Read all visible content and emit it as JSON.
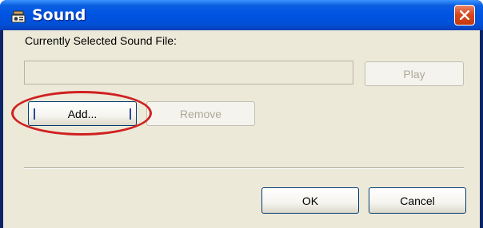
{
  "window": {
    "title": "Sound",
    "app_icon": "sound-app-icon",
    "close_icon": "close-icon",
    "close_color": "#d9481d"
  },
  "dialog": {
    "selected_label": "Currently Selected Sound File:",
    "selected_file_value": "",
    "buttons": {
      "play": "Play",
      "add": "Add...",
      "remove": "Remove",
      "ok": "OK",
      "cancel": "Cancel"
    }
  },
  "colors": {
    "titlebar": "#0054e3",
    "client": "#ece9d8",
    "highlight": "#d02020"
  }
}
